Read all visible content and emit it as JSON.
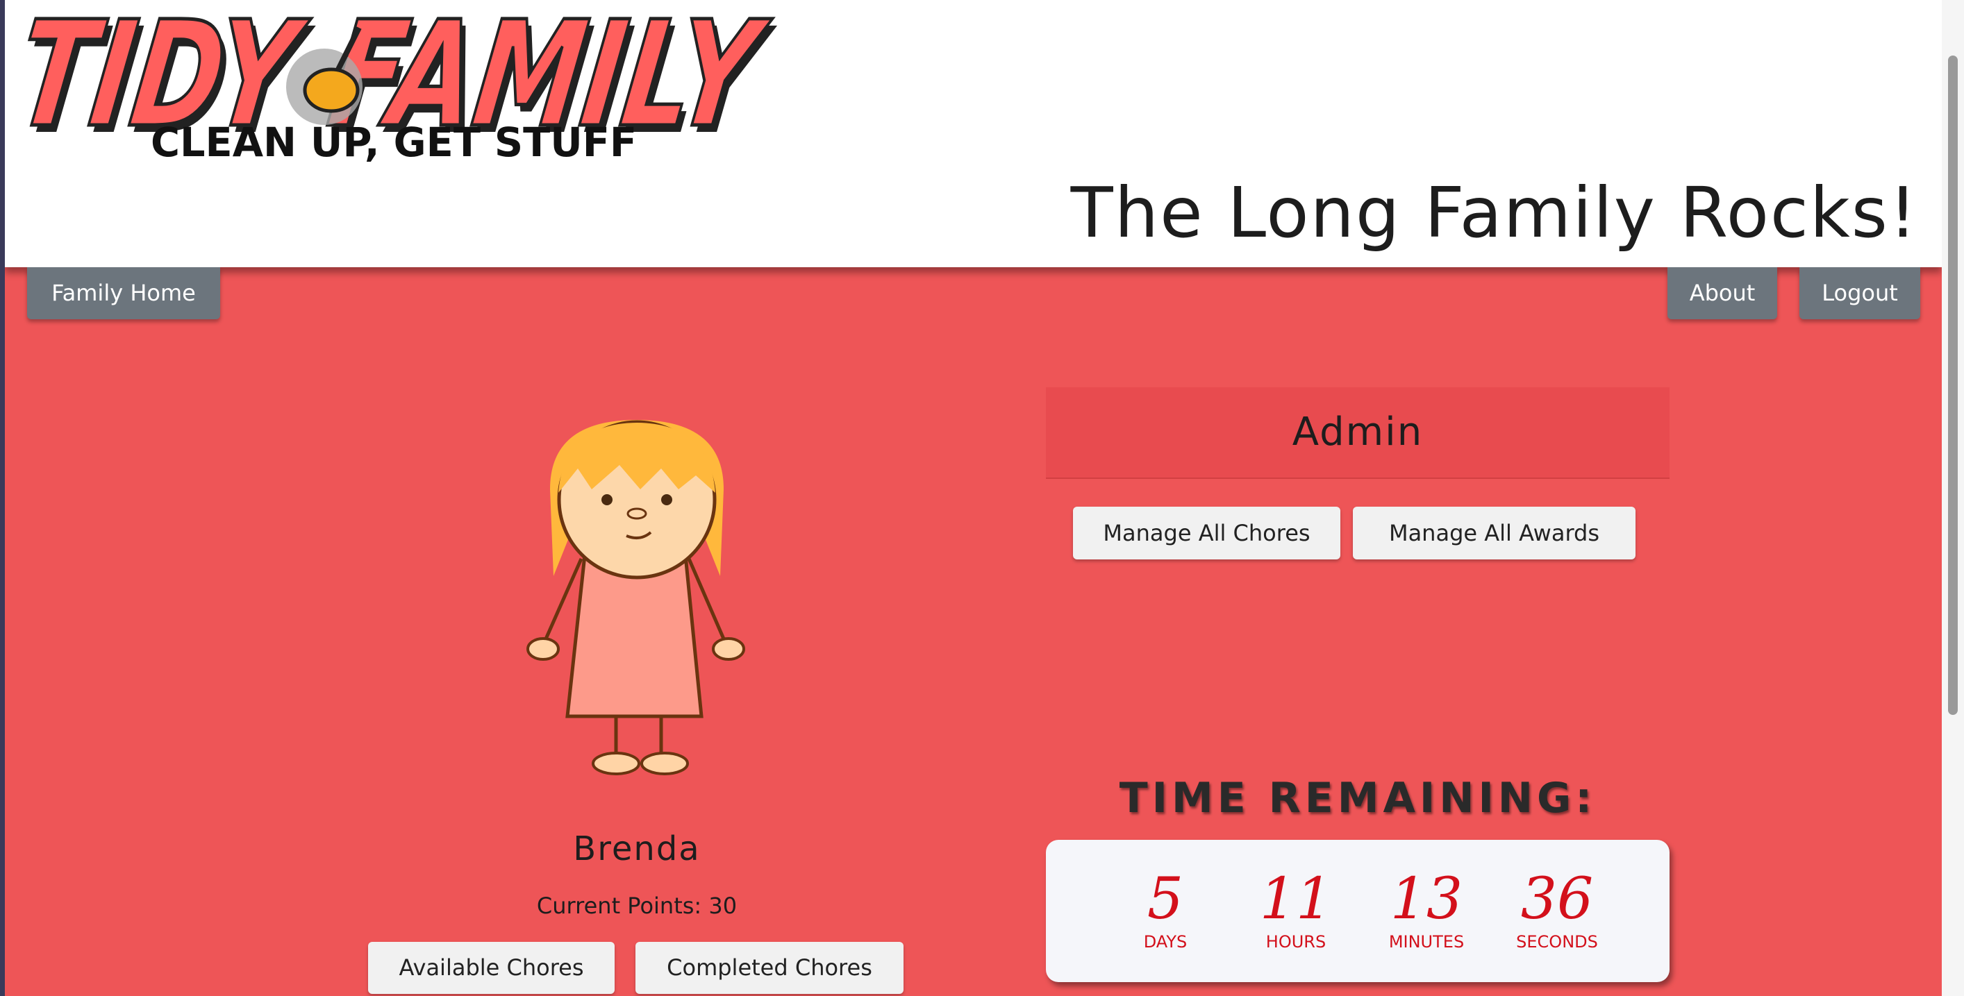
{
  "app": {
    "logo_main": "TIDY FAMILY",
    "logo_tagline": "CLEAN UP, GET STUFF",
    "site_title": "The Long Family Rocks!"
  },
  "nav": {
    "home_label": "Family Home",
    "about_label": "About",
    "logout_label": "Logout"
  },
  "child": {
    "name": "Brenda",
    "points_text": "Current Points: 30",
    "available_label": "Available Chores",
    "completed_label": "Completed Chores"
  },
  "admin": {
    "title": "Admin",
    "manage_chores_label": "Manage All Chores",
    "manage_awards_label": "Manage All Awards"
  },
  "countdown": {
    "title": "TIME REMAINING:",
    "days": "5",
    "days_label": "DAYS",
    "hours": "11",
    "hours_label": "HOURS",
    "minutes": "13",
    "minutes_label": "MINUTES",
    "seconds": "36",
    "seconds_label": "SECONDS"
  },
  "colors": {
    "page_bg": "#ee5557",
    "logo_red": "#ff5f5d",
    "nav_button": "#6c757d",
    "timer_red": "#d3101b",
    "hair": "#ffb83c",
    "dress": "#fd9a8a"
  },
  "icons": {
    "broom": "broom-icon",
    "avatar": "girl-avatar"
  }
}
